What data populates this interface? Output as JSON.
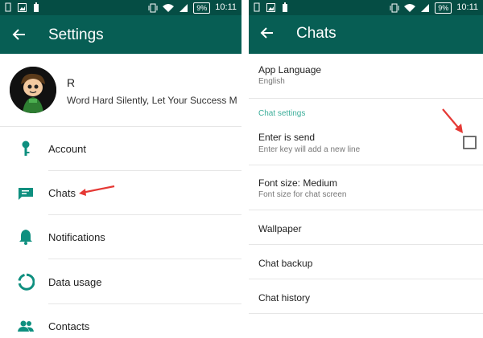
{
  "status_bar": {
    "battery": "9%",
    "time": "10:11"
  },
  "settings": {
    "title": "Settings",
    "profile": {
      "name": "R",
      "status": "Word Hard Silently, Let Your Success Make..."
    },
    "items": [
      {
        "label": "Account",
        "icon": "key-icon"
      },
      {
        "label": "Chats",
        "icon": "chat-icon"
      },
      {
        "label": "Notifications",
        "icon": "bell-icon"
      },
      {
        "label": "Data usage",
        "icon": "data-usage-icon"
      },
      {
        "label": "Contacts",
        "icon": "contacts-icon"
      }
    ]
  },
  "chats": {
    "title": "Chats",
    "app_language": {
      "title": "App Language",
      "value": "English"
    },
    "section_label": "Chat settings",
    "enter_is_send": {
      "title": "Enter is send",
      "subtitle": "Enter key will add a new line",
      "checked": false
    },
    "font_size": {
      "title": "Font size: Medium",
      "subtitle": "Font size for chat screen"
    },
    "wallpaper": "Wallpaper",
    "chat_backup": "Chat backup",
    "chat_history": "Chat history"
  },
  "colors": {
    "header": "#075e54",
    "statusbar": "#054d44",
    "accent": "#3cae9a",
    "arrow": "#e53935"
  }
}
